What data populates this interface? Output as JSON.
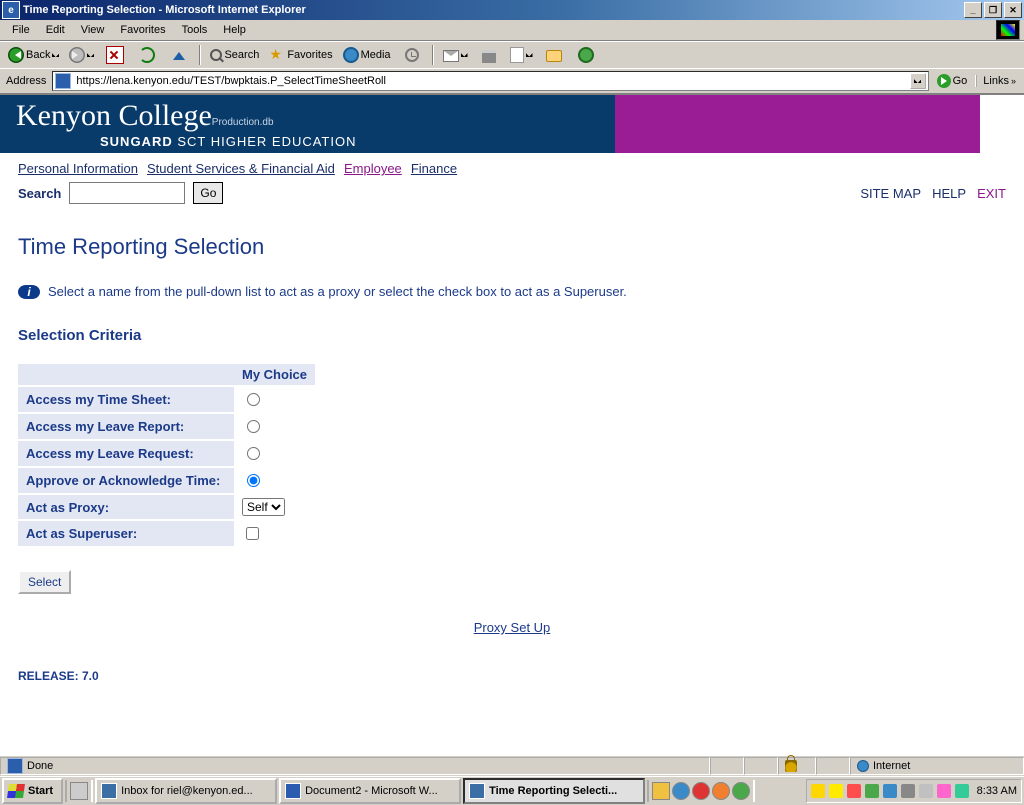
{
  "window": {
    "title": "Time Reporting Selection - Microsoft Internet Explorer"
  },
  "menus": {
    "file": "File",
    "edit": "Edit",
    "view": "View",
    "favorites": "Favorites",
    "tools": "Tools",
    "help": "Help"
  },
  "toolbar": {
    "back": "Back",
    "search": "Search",
    "favorites": "Favorites",
    "media": "Media"
  },
  "address": {
    "label": "Address",
    "url": "https://lena.kenyon.edu/TEST/bwpktais.P_SelectTimeSheetRoll",
    "go": "Go",
    "links": "Links"
  },
  "banner": {
    "college": "Kenyon College",
    "env": "Production.db",
    "sungard_bold": "SUNGARD",
    "sungard_rest": " SCT HIGHER EDUCATION"
  },
  "tabs": {
    "personal": "Personal Information",
    "ssfa": "Student Services & Financial Aid",
    "employee": "Employee",
    "finance": "Finance"
  },
  "util": {
    "sitemap": "SITE MAP",
    "help": "HELP",
    "exit": "EXIT"
  },
  "search": {
    "label": "Search",
    "placeholder": "",
    "go": "Go"
  },
  "page": {
    "title": "Time Reporting Selection",
    "info": "Select a name from the pull-down list to act as a proxy or select the check box to act as a Superuser.",
    "section": "Selection Criteria",
    "col_choice": "My Choice",
    "rows": {
      "timesheet": "Access my Time Sheet:",
      "leavereport": "Access my Leave Report:",
      "leaverequest": "Access my Leave Request:",
      "approve": "Approve or Acknowledge Time:",
      "proxy": "Act as Proxy:",
      "superuser": "Act as Superuser:"
    },
    "proxy_value": "Self",
    "select_btn": "Select",
    "proxy_setup": "Proxy Set Up",
    "release": "RELEASE: 7.0"
  },
  "status": {
    "done": "Done",
    "zone": "Internet"
  },
  "taskbar": {
    "start": "Start",
    "tasks": [
      "Inbox for riel@kenyon.ed...",
      "Document2 - Microsoft W...",
      "Time Reporting Selecti..."
    ],
    "clock": "8:33 AM"
  }
}
